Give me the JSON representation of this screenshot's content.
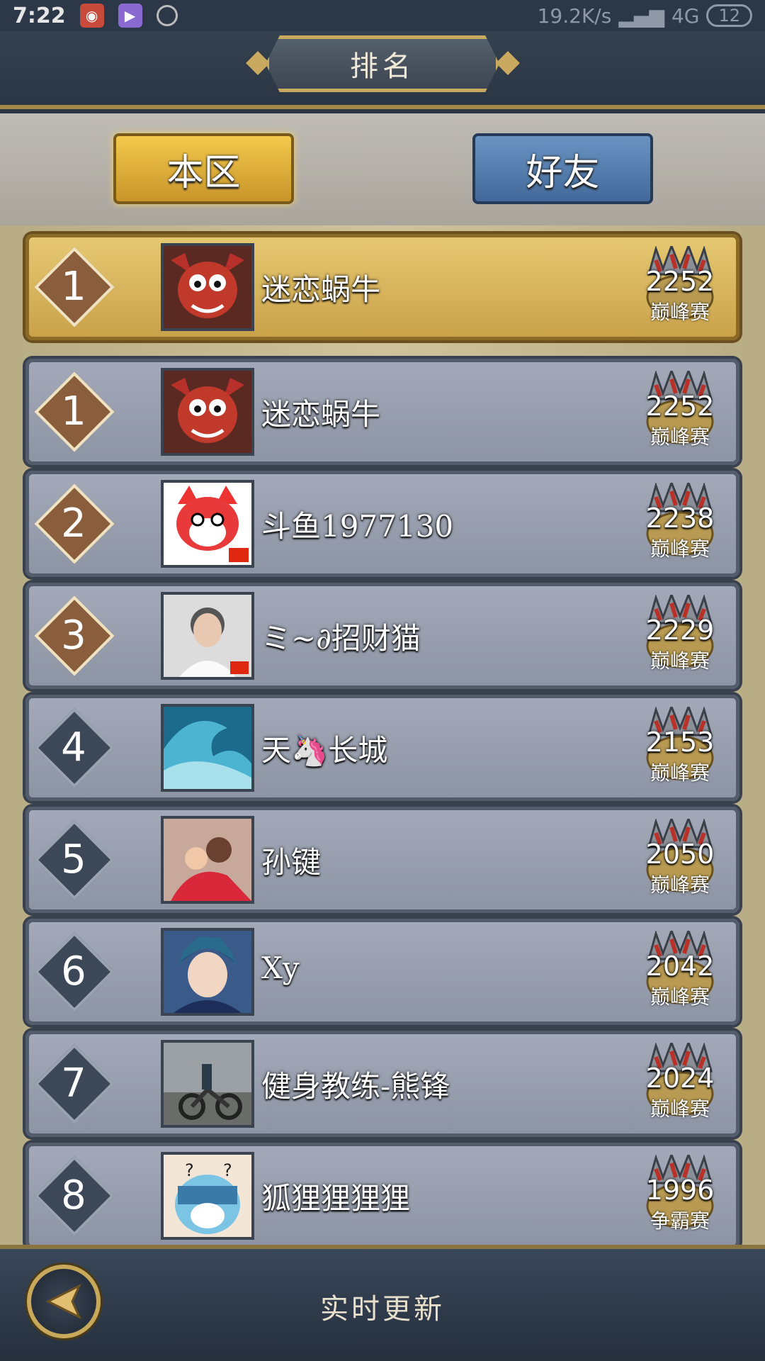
{
  "status_bar": {
    "time": "7:22",
    "network_speed": "19.2K/s",
    "network_type": "4G",
    "battery": "12"
  },
  "header": {
    "title": "排名"
  },
  "tabs": [
    {
      "label": "本区",
      "active": true
    },
    {
      "label": "好友",
      "active": false
    }
  ],
  "my_entry": {
    "rank": "1",
    "name": "迷恋蜗牛",
    "score": "2252",
    "league": "巅峰赛",
    "avatar": "red-dragon-icon"
  },
  "rankings": [
    {
      "rank": "1",
      "name": "迷恋蜗牛",
      "score": "2252",
      "league": "巅峰赛",
      "avatar": "red-dragon-icon"
    },
    {
      "rank": "2",
      "name": "斗鱼1977130",
      "score": "2238",
      "league": "巅峰赛",
      "avatar": "red-fox-icon"
    },
    {
      "rank": "3",
      "name": "ミ~∂招财猫",
      "score": "2229",
      "league": "巅峰赛",
      "avatar": "portrait-photo"
    },
    {
      "rank": "4",
      "name": "天🦄长城",
      "score": "2153",
      "league": "巅峰赛",
      "avatar": "wave-photo"
    },
    {
      "rank": "5",
      "name": "孙键",
      "score": "2050",
      "league": "巅峰赛",
      "avatar": "family-photo"
    },
    {
      "rank": "6",
      "name": "Xy",
      "score": "2042",
      "league": "巅峰赛",
      "avatar": "anime-boy-icon"
    },
    {
      "rank": "7",
      "name": "健身教练-熊锋",
      "score": "2024",
      "league": "巅峰赛",
      "avatar": "motorcycle-photo"
    },
    {
      "rank": "8",
      "name": "狐狸狸狸狸",
      "score": "1996",
      "league": "争霸赛",
      "avatar": "squirtle-icon"
    }
  ],
  "footer": {
    "text": "实时更新"
  },
  "colors": {
    "gold": "#c9a860",
    "top_rank": "#8a5e3c",
    "plain_rank": "#3c4858",
    "active_tab": "#e6b640",
    "inactive_tab": "#5a82b3"
  }
}
